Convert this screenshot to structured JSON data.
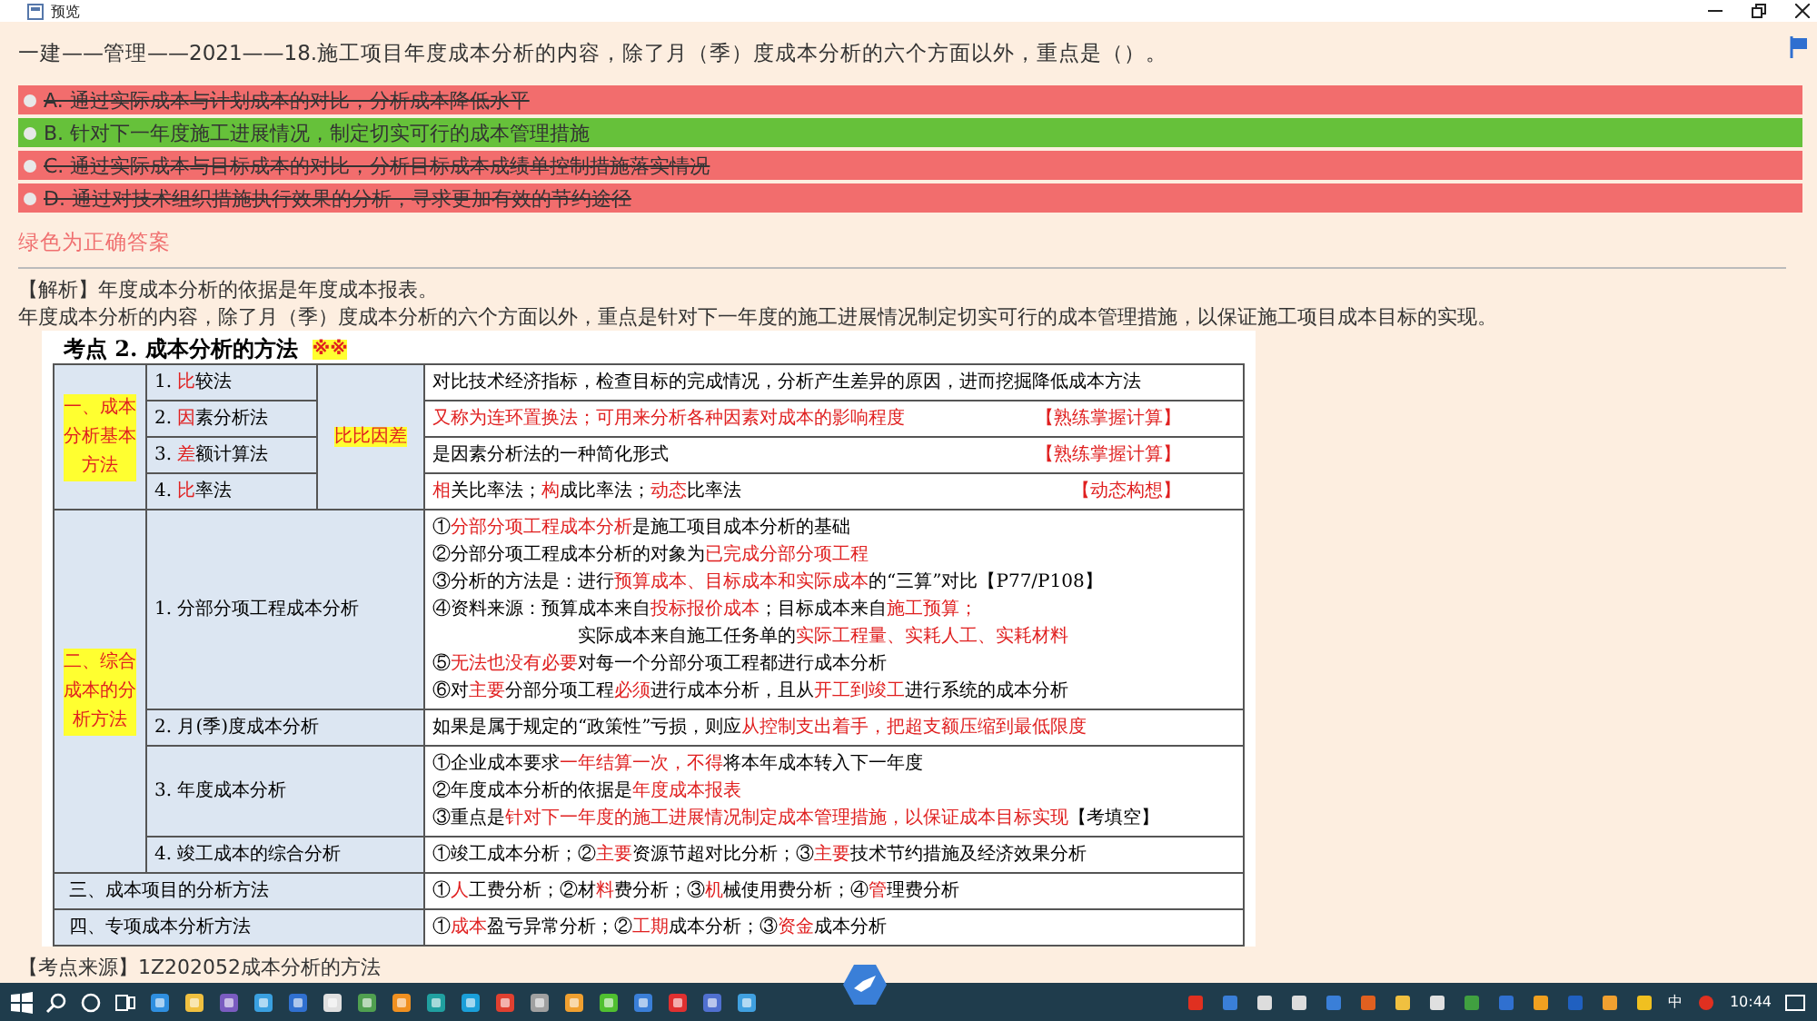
{
  "window": {
    "title": "预览"
  },
  "question": "一建——管理——2021——18.施工项目年度成本分析的内容，除了月（季）度成本分析的六个方面以外，重点是（）。",
  "options": [
    {
      "text": "A. 通过实际成本与计划成本的对比，分析成本降低水平",
      "correct": false
    },
    {
      "text": "B. 针对下一年度施工进展情况，制定切实可行的成本管理措施",
      "correct": true
    },
    {
      "text": "C. 通过实际成本与目标成本的对比，分析目标成本成绩单控制措施落实情况",
      "correct": false
    },
    {
      "text": "D. 通过对技术组织措施执行效果的分析，寻求更加有效的节约途径",
      "correct": false
    }
  ],
  "answer_note": "绿色为正确答案",
  "analysis": [
    "【解析】年度成本分析的依据是年度成本报表。",
    "年度成本分析的内容，除了月（季）度成本分析的六个方面以外，重点是针对下一年度的施工进展情况制定切实可行的成本管理措施，以保证施工项目成本目标的实现。"
  ],
  "exam_table": {
    "title": "考点 2. 成本分析的方法",
    "title_mark": "※※",
    "groups": [
      {
        "label": "一、成本分析基本方法",
        "mnemonic": "比比因差",
        "rows": [
          {
            "method": [
              {
                "text": "1. ",
                "emphasis": false
              },
              {
                "text": "比",
                "emphasis": true
              },
              {
                "text": "较法",
                "emphasis": false
              }
            ],
            "lines": [
              {
                "segs": [
                  {
                    "text": "对比技术经济指标，检查目标的完成情况，分析产生差异的原因，进而挖掘降低成本方法",
                    "emphasis": false
                  }
                ]
              }
            ]
          },
          {
            "method": [
              {
                "text": "2. ",
                "emphasis": false
              },
              {
                "text": "因",
                "emphasis": true
              },
              {
                "text": "素分析法",
                "emphasis": false
              }
            ],
            "lines": [
              {
                "segs": [
                  {
                    "text": "又称为连环置换法；可用来分析各种因素对成本的影响程度",
                    "emphasis": true
                  }
                ]
              }
            ],
            "tag": "【熟练掌握计算】"
          },
          {
            "method": [
              {
                "text": "3. ",
                "emphasis": false
              },
              {
                "text": "差",
                "emphasis": true
              },
              {
                "text": "额计算法",
                "emphasis": false
              }
            ],
            "lines": [
              {
                "segs": [
                  {
                    "text": "是因素分析法的一种简化形式",
                    "emphasis": false
                  }
                ]
              }
            ],
            "tag": "【熟练掌握计算】"
          },
          {
            "method": [
              {
                "text": "4. ",
                "emphasis": false
              },
              {
                "text": "比",
                "emphasis": true
              },
              {
                "text": "率法",
                "emphasis": false
              }
            ],
            "lines": [
              {
                "segs": [
                  {
                    "text": "相",
                    "emphasis": true
                  },
                  {
                    "text": "关比率法；",
                    "emphasis": false
                  },
                  {
                    "text": "构",
                    "emphasis": true
                  },
                  {
                    "text": "成比率法；",
                    "emphasis": false
                  },
                  {
                    "text": "动态",
                    "emphasis": true
                  },
                  {
                    "text": "比率法",
                    "emphasis": false
                  }
                ]
              }
            ],
            "tag": "【动态构想】"
          }
        ]
      },
      {
        "label": "二、综合成本的分析方法",
        "rows": [
          {
            "method": [
              {
                "text": "1. 分部分项工程成本分析",
                "emphasis": false
              }
            ],
            "lines": [
              {
                "segs": [
                  {
                    "text": "①",
                    "emphasis": false
                  },
                  {
                    "text": "分部分项工程成本分析",
                    "emphasis": true
                  },
                  {
                    "text": "是施工项目成本分析的基础",
                    "emphasis": false
                  }
                ]
              },
              {
                "segs": [
                  {
                    "text": "②分部分项工程成本分析的对象为",
                    "emphasis": false
                  },
                  {
                    "text": "已完成分部分项工程",
                    "emphasis": true
                  }
                ]
              },
              {
                "segs": [
                  {
                    "text": "③分析的方法是：进行",
                    "emphasis": false
                  },
                  {
                    "text": "预算成本、目标成本和实际成本",
                    "emphasis": true
                  },
                  {
                    "text": "的“三算”对比【P77/P108】",
                    "emphasis": false
                  }
                ]
              },
              {
                "segs": [
                  {
                    "text": "④资料来源：预算成本来自",
                    "emphasis": false
                  },
                  {
                    "text": "投标报价成本",
                    "emphasis": true
                  },
                  {
                    "text": "；目标成本来自",
                    "emphasis": false
                  },
                  {
                    "text": "施工预算；",
                    "emphasis": true
                  }
                ],
                "cont": [
                  {
                    "text": "实际成本来自施工任务单的",
                    "emphasis": false
                  },
                  {
                    "text": "实际工程量、实耗人工、实耗材料",
                    "emphasis": true
                  }
                ]
              },
              {
                "segs": [
                  {
                    "text": "⑤",
                    "emphasis": false
                  },
                  {
                    "text": "无法也没有必要",
                    "emphasis": true
                  },
                  {
                    "text": "对每一个分部分项工程都进行成本分析",
                    "emphasis": false
                  }
                ]
              },
              {
                "segs": [
                  {
                    "text": "⑥对",
                    "emphasis": false
                  },
                  {
                    "text": "主要",
                    "emphasis": true
                  },
                  {
                    "text": "分部分项工程",
                    "emphasis": false
                  },
                  {
                    "text": "必须",
                    "emphasis": true
                  },
                  {
                    "text": "进行成本分析，且从",
                    "emphasis": false
                  },
                  {
                    "text": "开工到竣工",
                    "emphasis": true
                  },
                  {
                    "text": "进行系统的成本分析",
                    "emphasis": false
                  }
                ]
              }
            ]
          },
          {
            "method": [
              {
                "text": "2. 月(季)度成本分析",
                "emphasis": false
              }
            ],
            "lines": [
              {
                "segs": [
                  {
                    "text": "如果是属于规定的“政策性”亏损，则应",
                    "emphasis": false
                  },
                  {
                    "text": "从控制支出着手，把超支额压缩到最低限度",
                    "emphasis": true
                  }
                ]
              }
            ]
          },
          {
            "method": [
              {
                "text": "3. 年度成本分析",
                "emphasis": false
              }
            ],
            "lines": [
              {
                "segs": [
                  {
                    "text": "①企业成本要求",
                    "emphasis": false
                  },
                  {
                    "text": "一年结算一次，不得",
                    "emphasis": true
                  },
                  {
                    "text": "将本年成本转入下一年度",
                    "emphasis": false
                  }
                ]
              },
              {
                "segs": [
                  {
                    "text": "②年度成本分析的依据是",
                    "emphasis": false
                  },
                  {
                    "text": "年度成本报表",
                    "emphasis": true
                  }
                ]
              },
              {
                "segs": [
                  {
                    "text": "③重点是",
                    "emphasis": false
                  },
                  {
                    "text": "针对下一年度的施工进展情况制定成本管理措施，以保证成本目标实现",
                    "emphasis": true
                  },
                  {
                    "text": "【考填空】",
                    "emphasis": false
                  }
                ]
              }
            ]
          },
          {
            "method": [
              {
                "text": "4. 竣工成本的综合分析",
                "emphasis": false
              }
            ],
            "lines": [
              {
                "segs": [
                  {
                    "text": "①竣工成本分析；②",
                    "emphasis": false
                  },
                  {
                    "text": "主要",
                    "emphasis": true
                  },
                  {
                    "text": "资源节超对比分析；③",
                    "emphasis": false
                  },
                  {
                    "text": "主要",
                    "emphasis": true
                  },
                  {
                    "text": "技术节约措施及经济效果分析",
                    "emphasis": false
                  }
                ]
              }
            ]
          }
        ]
      }
    ],
    "single_rows": [
      {
        "label": "三、成本项目的分析方法",
        "lines": [
          {
            "segs": [
              {
                "text": "①",
                "emphasis": false
              },
              {
                "text": "人",
                "emphasis": true
              },
              {
                "text": "工费分析；②材",
                "emphasis": false
              },
              {
                "text": "料",
                "emphasis": true
              },
              {
                "text": "费分析；③",
                "emphasis": false
              },
              {
                "text": "机",
                "emphasis": true
              },
              {
                "text": "械使用费分析；④",
                "emphasis": false
              },
              {
                "text": "管",
                "emphasis": true
              },
              {
                "text": "理费分析",
                "emphasis": false
              }
            ]
          }
        ]
      },
      {
        "label": "四、专项成本分析方法",
        "lines": [
          {
            "segs": [
              {
                "text": "①",
                "emphasis": false
              },
              {
                "text": "成本",
                "emphasis": true
              },
              {
                "text": "盈亏异常分析；②",
                "emphasis": false
              },
              {
                "text": "工期",
                "emphasis": true
              },
              {
                "text": "成本分析；③",
                "emphasis": false
              },
              {
                "text": "资金",
                "emphasis": true
              },
              {
                "text": "成本分析",
                "emphasis": false
              }
            ]
          }
        ]
      }
    ]
  },
  "source_note": "【考点来源】1Z202052成本分析的方法",
  "taskbar": {
    "input_method": "中",
    "clock": "10:44"
  }
}
